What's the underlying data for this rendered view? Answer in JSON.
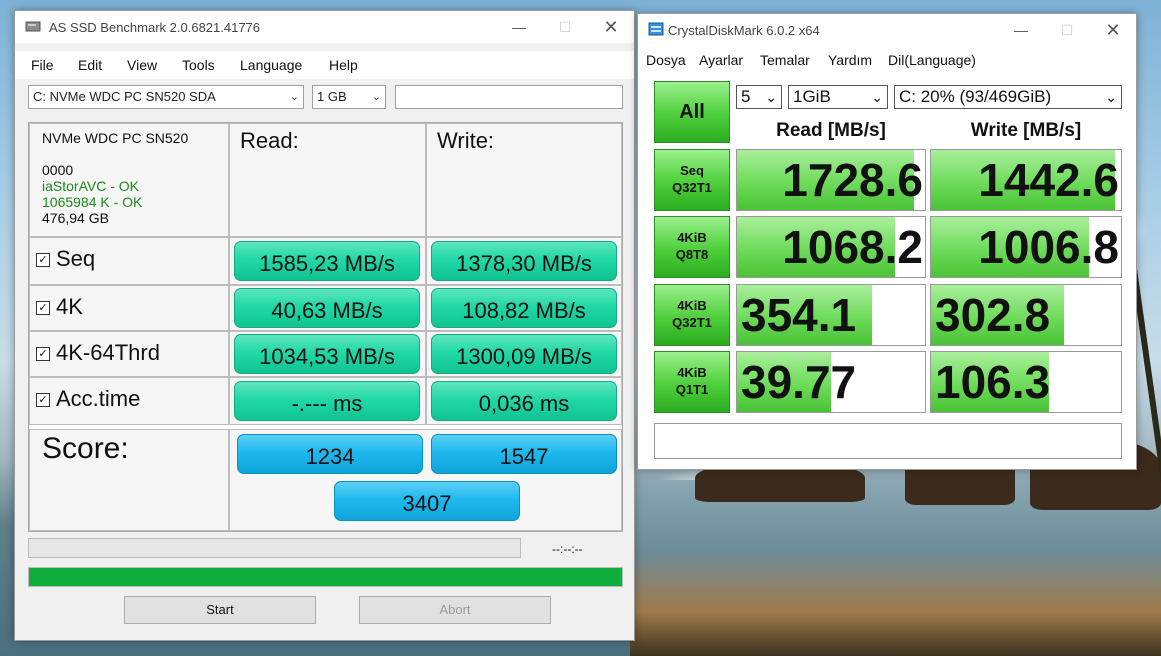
{
  "as_ssd": {
    "title": "AS SSD Benchmark 2.0.6821.41776",
    "menu": [
      "File",
      "Edit",
      "View",
      "Tools",
      "Language",
      "Help"
    ],
    "drive_select": "C: NVMe WDC PC SN520 SDA",
    "size_select": "1 GB",
    "info": {
      "model": "NVMe WDC PC SN520",
      "firmware": "0000",
      "driver": "iaStorAVC - OK",
      "alignment": "1065984 K - OK",
      "capacity": "476,94 GB"
    },
    "read_header": "Read:",
    "write_header": "Write:",
    "rows": [
      {
        "label": "Seq",
        "read": "1585,23 MB/s",
        "write": "1378,30 MB/s"
      },
      {
        "label": "4K",
        "read": "40,63 MB/s",
        "write": "108,82 MB/s"
      },
      {
        "label": "4K-64Thrd",
        "read": "1034,53 MB/s",
        "write": "1300,09 MB/s"
      },
      {
        "label": "Acc.time",
        "read": "-.--- ms",
        "write": "0,036 ms"
      }
    ],
    "score_label": "Score:",
    "score_read": "1234",
    "score_write": "1547",
    "score_total": "3407",
    "time": "--:--:--",
    "progress": 1.0,
    "start_label": "Start",
    "abort_label": "Abort",
    "colors": {
      "value": "#21d8a6",
      "score": "#1fb9ee",
      "progress": "#0fae3a"
    }
  },
  "cdm": {
    "title": "CrystalDiskMark 6.0.2 x64",
    "menu": [
      "Dosya",
      "Ayarlar",
      "Temalar",
      "Yardım",
      "Dil(Language)"
    ],
    "all_label": "All",
    "count_select": "5",
    "size_select": "1GiB",
    "drive_select": "C: 20% (93/469GiB)",
    "read_header": "Read [MB/s]",
    "write_header": "Write [MB/s]",
    "tests": [
      {
        "line1": "Seq",
        "line2": "Q32T1",
        "read": "1728.6",
        "write": "1442.6",
        "read_fill": 0.94,
        "write_fill": 0.97
      },
      {
        "line1": "4KiB",
        "line2": "Q8T8",
        "read": "1068.2",
        "write": "1006.8",
        "read_fill": 0.84,
        "write_fill": 0.83
      },
      {
        "line1": "4KiB",
        "line2": "Q32T1",
        "read": "354.1",
        "write": "302.8",
        "read_fill": 0.72,
        "write_fill": 0.7
      },
      {
        "line1": "4KiB",
        "line2": "Q1T1",
        "read": "39.77",
        "write": "106.3",
        "read_fill": 0.5,
        "write_fill": 0.62
      }
    ],
    "colors": {
      "button": "#4dcf3a",
      "bar": "#6edb5a"
    }
  }
}
